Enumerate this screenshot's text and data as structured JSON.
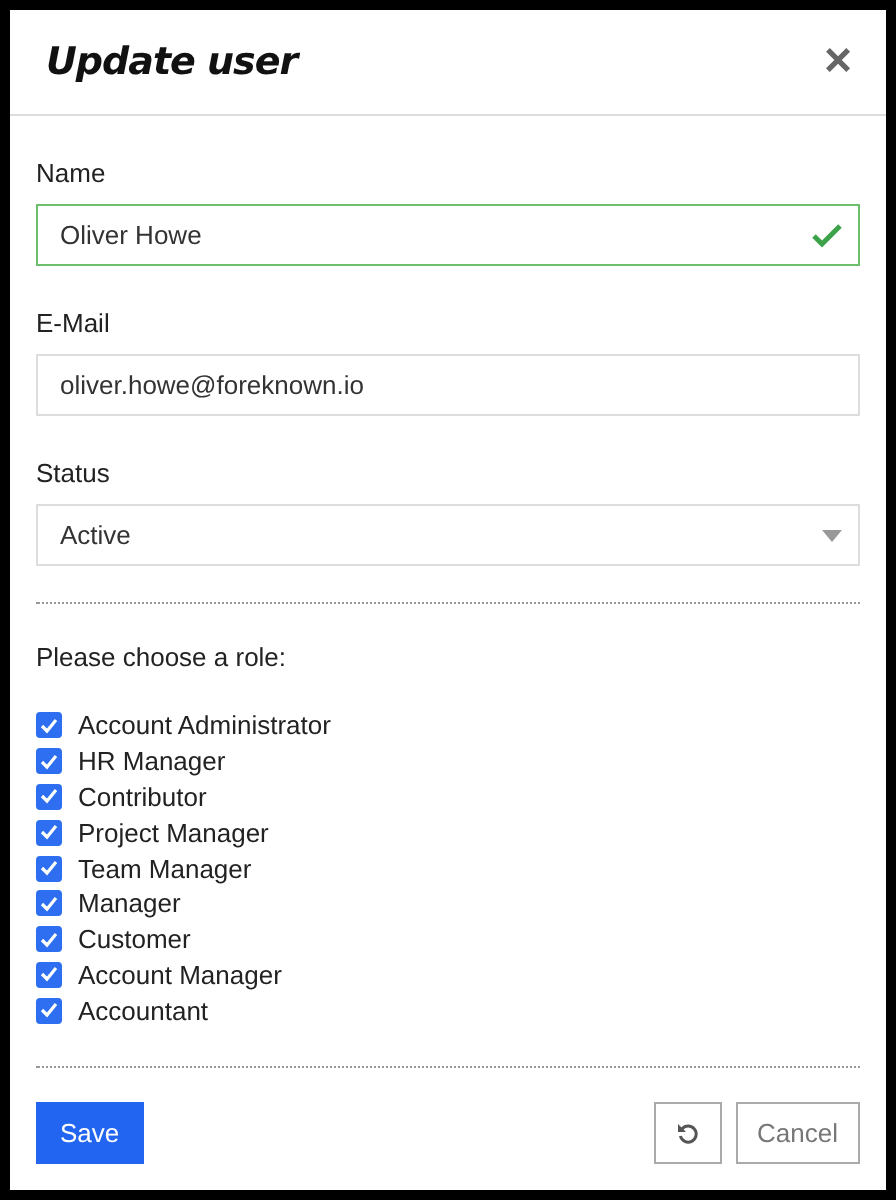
{
  "dialog": {
    "title": "Update user",
    "close": "×"
  },
  "fields": [
    {
      "kind": "text",
      "label": "Name",
      "value": "Oliver Howe",
      "valid": true
    },
    {
      "kind": "text",
      "label": "E-Mail",
      "value": "oliver.howe@foreknown.io",
      "valid": false
    },
    {
      "kind": "select",
      "label": "Status",
      "value": "Active"
    }
  ],
  "roles": {
    "prompt": "Please choose a role:",
    "items": [
      {
        "label": "Account Administrator",
        "checked": true
      },
      {
        "label": "HR Manager",
        "checked": true
      },
      {
        "label": "Contributor",
        "checked": true
      },
      {
        "label": "Project Manager",
        "checked": true
      },
      {
        "label": "Team Manager",
        "checked": true
      },
      {
        "label": "Manager",
        "checked": true
      },
      {
        "label": "Customer",
        "checked": true
      },
      {
        "label": "Account Manager",
        "checked": true
      },
      {
        "label": "Accountant",
        "checked": true
      }
    ]
  },
  "buttons": {
    "save": "Save",
    "cancel": "Cancel"
  }
}
